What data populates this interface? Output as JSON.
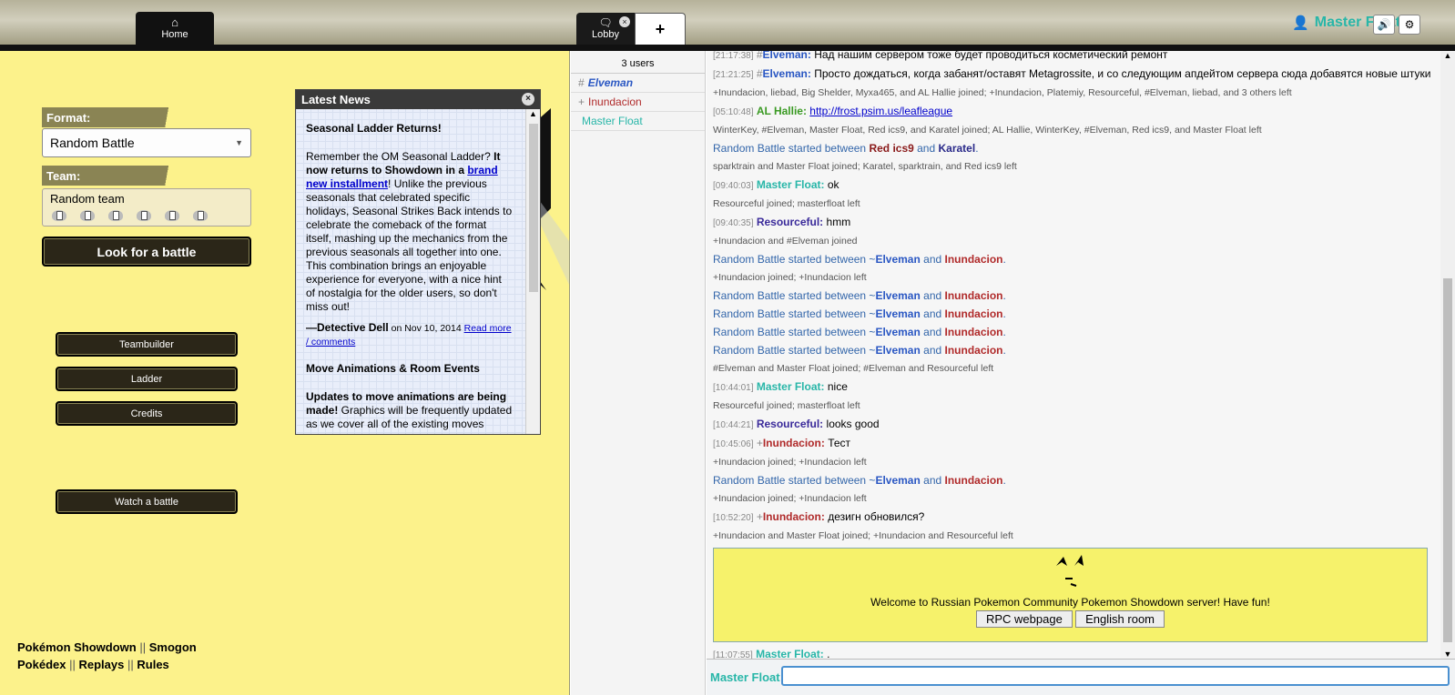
{
  "header": {
    "tabs": [
      {
        "label": "Home",
        "icon": "home-icon"
      },
      {
        "label": "Lobby",
        "icon": "chat-bubble-icon"
      }
    ],
    "new_tab_label": "+",
    "username": "Master Float",
    "close_label": "×"
  },
  "main": {
    "format_label": "Format:",
    "format_value": "Random Battle",
    "team_label": "Team:",
    "team_value": "Random team",
    "search_button": "Look for a battle",
    "menu": [
      "Teambuilder",
      "Ladder",
      "Credits"
    ],
    "watch_button": "Watch a battle",
    "footer": {
      "l1a": "Pokémon Showdown",
      "l1b": "Smogon",
      "l2a": "Pokédex",
      "l2b": "Replays",
      "l2c": "Rules",
      "sep": "||"
    }
  },
  "news": {
    "title": "Latest News",
    "items": [
      {
        "heading": "Seasonal Ladder Returns!",
        "p1a": "Remember the OM Seasonal Ladder? ",
        "p1b": "It now returns to Showdown in a ",
        "p1link": "brand new installment",
        "p1c": "! Unlike the previous seasonals that celebrated specific holidays, Seasonal Strikes Back intends to celebrate the comeback of the format itself, mashing up the mechanics from the previous seasonals all together into one. This combination brings an enjoyable experience for everyone, with a nice hint of nostalgia for the older users, so don't miss out!",
        "author": "—Detective Dell",
        "date": " on Nov 10, 2014 ",
        "more": "Read more / comments"
      },
      {
        "heading": "Move Animations & Room Events",
        "p1b": "Updates to move animations are being made!",
        "p1c": " Graphics will be frequently updated as we cover all of the existing moves"
      }
    ]
  },
  "userlist": {
    "count": "3 users",
    "users": [
      {
        "rank": "#",
        "name": "Elveman",
        "color": "#2a57c3"
      },
      {
        "rank": "+",
        "name": "Inundacion",
        "color": "#b02a2a"
      },
      {
        "rank": "",
        "name": "Master Float",
        "color": "#28b6a8"
      }
    ]
  },
  "chat": {
    "lines": [
      {
        "type": "msg",
        "ts": "[21:17:38]",
        "rank": "#",
        "name": "Elveman:",
        "color": "#2a57c3",
        "text": "Над нашим сервером тоже будет проводиться косметический ремонт"
      },
      {
        "type": "msg",
        "ts": "[21:21:25]",
        "rank": "#",
        "name": "Elveman:",
        "color": "#2a57c3",
        "text": "Просто дождаться, когда забанят/оставят Metagrossite, и со следующим апдейтом сервера сюда добавятся новые штуки"
      },
      {
        "type": "notice",
        "text": "+Inundacion, liebad, Big Shelder, Myxa465, and AL Hallie joined; +Inundacion, Platemiy, Resourceful, #Elveman, liebad, and 3 others left"
      },
      {
        "type": "msg",
        "ts": "[05:10:48]",
        "rank": "",
        "name": "AL Hallie:",
        "color": "#3a9a23",
        "text": "http://frost.psim.us/leafleague",
        "link": true
      },
      {
        "type": "notice",
        "text": "WinterKey, #Elveman, Master Float, Red ics9, and Karatel joined; AL Hallie, WinterKey, #Elveman, Red ics9, and Master Float left"
      },
      {
        "type": "battle",
        "pre": "Random Battle started between ",
        "p1": "Red ics9",
        "p1c": "#8a1a1a",
        "mid": " and ",
        "p2": "Karatel",
        "p2c": "#2a2a8a",
        "post": "."
      },
      {
        "type": "notice",
        "text": "sparktrain and Master Float joined; Karatel, sparktrain, and Red ics9 left"
      },
      {
        "type": "msg",
        "ts": "[09:40:03]",
        "rank": "",
        "name": "Master Float:",
        "color": "#28b6a8",
        "text": "ok"
      },
      {
        "type": "notice",
        "text": "Resourceful joined; masterfloat left"
      },
      {
        "type": "msg",
        "ts": "[09:40:35]",
        "rank": "",
        "name": "Resourceful:",
        "color": "#3a2a9a",
        "text": "hmm"
      },
      {
        "type": "notice",
        "text": "+Inundacion and #Elveman joined"
      },
      {
        "type": "battle",
        "pre": "Random Battle started between ~",
        "p1": "Elveman",
        "p1c": "#2a57c3",
        "mid": " and ",
        "p2": "Inundacion",
        "p2c": "#b02a2a",
        "post": "."
      },
      {
        "type": "notice",
        "text": "+Inundacion joined; +Inundacion left"
      },
      {
        "type": "battle",
        "pre": "Random Battle started between ~",
        "p1": "Elveman",
        "p1c": "#2a57c3",
        "mid": " and ",
        "p2": "Inundacion",
        "p2c": "#b02a2a",
        "post": "."
      },
      {
        "type": "battle",
        "pre": "Random Battle started between ~",
        "p1": "Elveman",
        "p1c": "#2a57c3",
        "mid": " and ",
        "p2": "Inundacion",
        "p2c": "#b02a2a",
        "post": "."
      },
      {
        "type": "battle",
        "pre": "Random Battle started between ~",
        "p1": "Elveman",
        "p1c": "#2a57c3",
        "mid": " and ",
        "p2": "Inundacion",
        "p2c": "#b02a2a",
        "post": "."
      },
      {
        "type": "battle",
        "pre": "Random Battle started between ~",
        "p1": "Elveman",
        "p1c": "#2a57c3",
        "mid": " and ",
        "p2": "Inundacion",
        "p2c": "#b02a2a",
        "post": "."
      },
      {
        "type": "notice",
        "text": "#Elveman and Master Float joined; #Elveman and Resourceful left"
      },
      {
        "type": "msg",
        "ts": "[10:44:01]",
        "rank": "",
        "name": "Master Float:",
        "color": "#28b6a8",
        "text": "nice"
      },
      {
        "type": "notice",
        "text": "Resourceful joined; masterfloat left"
      },
      {
        "type": "msg",
        "ts": "[10:44:21]",
        "rank": "",
        "name": "Resourceful:",
        "color": "#3a2a9a",
        "text": "looks good"
      },
      {
        "type": "msg",
        "ts": "[10:45:06]",
        "rank": "+",
        "name": "Inundacion:",
        "color": "#b02a2a",
        "text": "Тест"
      },
      {
        "type": "notice",
        "text": "+Inundacion joined; +Inundacion left"
      },
      {
        "type": "battle",
        "pre": "Random Battle started between ~",
        "p1": "Elveman",
        "p1c": "#2a57c3",
        "mid": " and ",
        "p2": "Inundacion",
        "p2c": "#b02a2a",
        "post": "."
      },
      {
        "type": "notice",
        "text": "+Inundacion joined; +Inundacion left"
      },
      {
        "type": "msg",
        "ts": "[10:52:20]",
        "rank": "+",
        "name": "Inundacion:",
        "color": "#b02a2a",
        "text": "дезигн обновился?"
      },
      {
        "type": "notice",
        "text": "+Inundacion and Master Float joined; +Inundacion and Resourceful left"
      }
    ],
    "welcome": {
      "text": "Welcome to Russian Pokemon Community Pokemon Showdown server! Have fun!",
      "button1": "RPC webpage",
      "button2": "English room"
    },
    "last": {
      "ts": "[11:07:55]",
      "name": "Master Float:",
      "color": "#28b6a8",
      "text": "."
    }
  },
  "composer": {
    "name": "Master Float"
  }
}
